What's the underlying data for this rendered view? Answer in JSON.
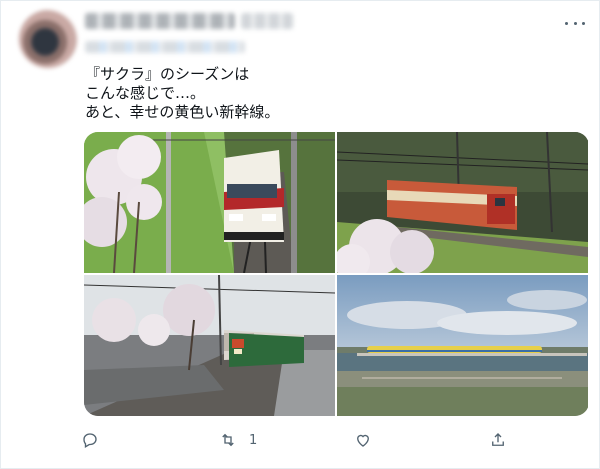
{
  "tweet": {
    "text_lines": [
      "『サクラ』のシーズンは",
      "こんな感じで…。",
      "あと、幸せの黄色い新幹線。"
    ]
  },
  "actions": {
    "reply_icon": "reply-icon",
    "retweet_icon": "retweet-icon",
    "retweet_count": "1",
    "like_icon": "heart-icon",
    "share_icon": "share-icon"
  },
  "photos": [
    {
      "name": "red-white-train-cherry-blossoms"
    },
    {
      "name": "orange-train-mountain-curve"
    },
    {
      "name": "green-train-station-platform"
    },
    {
      "name": "yellow-shinkansen-bridge"
    }
  ]
}
